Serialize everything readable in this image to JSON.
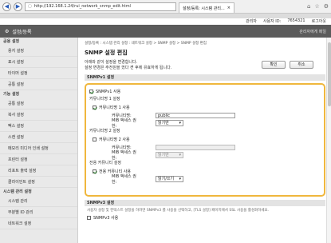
{
  "browser": {
    "url": "http://192.168.1.24/rui_network_snmp_edit.html",
    "tab_label": "설정/등록: 시스템 관리..."
  },
  "userbar": {
    "user_label": "관리자",
    "logout": "로그아웃",
    "dept_label": "사용자 ID:",
    "dept_id": "7654321",
    "extra": "로그인중"
  },
  "header": {
    "title": "설정/등록",
    "right": "관리자에게 메일"
  },
  "sidebar": [
    {
      "type": "section",
      "label": "공용 설정"
    },
    {
      "type": "item",
      "label": "용지 설정"
    },
    {
      "type": "item",
      "label": "표시 설정"
    },
    {
      "type": "item",
      "label": "타이머 설정"
    },
    {
      "type": "item",
      "label": "공통 설정"
    },
    {
      "type": "section",
      "label": "기능 설정"
    },
    {
      "type": "item",
      "label": "공통 설정"
    },
    {
      "type": "item",
      "label": "복사 설정"
    },
    {
      "type": "item",
      "label": "팩스 설정"
    },
    {
      "type": "item",
      "label": "스캔 설정"
    },
    {
      "type": "item",
      "label": "메모리 미디어 인쇄 설정"
    },
    {
      "type": "item",
      "label": "프린터 설정"
    },
    {
      "type": "item",
      "label": "리포트 출력 설정"
    },
    {
      "type": "item",
      "label": "클라이언트 설정"
    },
    {
      "type": "section",
      "label": "시스템 관리 설정"
    },
    {
      "type": "item",
      "label": "시스템 관리"
    },
    {
      "type": "item",
      "label": "부분별 ID 관리"
    },
    {
      "type": "item",
      "label": "네트워크 설정"
    }
  ],
  "main": {
    "breadcrumb": "설정/등록 : 시스템 관리 설정 : 네트워크 설정 > SNMP 설정 > SNMP 설정 편집",
    "title": "SNMP 설정 편집",
    "notice1": "아래와 같이 설정을 변경합니다.",
    "notice2": "설정 변경은 주전원을 껐다 켠 후에 유효하게 됩니다.",
    "ok_label": "확인",
    "cancel_label": "취소",
    "v1_header": "SNMPv1 설정",
    "use_v1": "SNMPv1 사용",
    "comm1_header": "커뮤니티명 1 설정",
    "comm1_use": "커뮤니티명 1 사용",
    "comm_name_label": "커뮤니티명:",
    "comm1_value": "public",
    "mib_label": "MIB 액세스 권한:",
    "mib1_value": "읽기만",
    "comm2_header": "커뮤니티명 2 설정",
    "comm2_use": "커뮤니티명 2 사용",
    "comm2_value": "",
    "mib2_value": "읽기만",
    "dedicated_header": "전용 커뮤니티 설정",
    "dedicated_use": "전용 커뮤니티 사용",
    "mib3_value": "읽기/쓰기",
    "v3_header": "SNMPv3 설정",
    "v3_note1": "사용자 설정 및 컨텍스트 설정을 하려면 SNMPv3 를 사용을 선택하고, [TLS 설정] 페이지에서 SSL 사용을 활성화하세요.",
    "v3_note2": "SNMPv3 사용"
  },
  "checks": {
    "use_v1": true,
    "comm1_use": true,
    "comm2_use": false,
    "dedicated_use": true
  }
}
